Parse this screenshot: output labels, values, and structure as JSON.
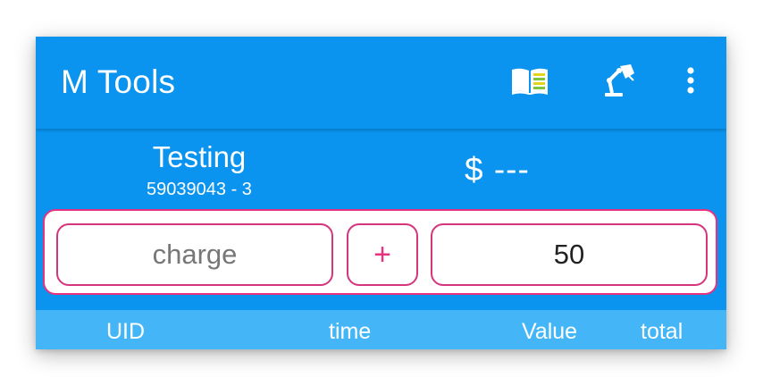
{
  "app": {
    "title": "M Tools",
    "primary_color": "#0a93ef",
    "accent_color": "#e8327f",
    "header_row_color": "#44b6f7"
  },
  "toolbar": {
    "icons": [
      "book-icon",
      "desk-lamp-icon",
      "more-vertical-icon"
    ]
  },
  "account": {
    "name": "Testing",
    "id": "59039043 - 3",
    "balance": "$ ---"
  },
  "charge_form": {
    "charge_placeholder": "charge",
    "charge_value": "",
    "plus_label": "+",
    "amount_value": "50"
  },
  "table": {
    "columns": [
      "UID",
      "time",
      "Value",
      "total"
    ]
  }
}
